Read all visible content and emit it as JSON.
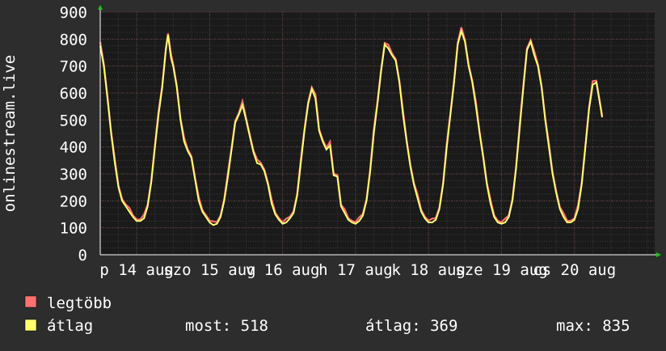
{
  "chart_data": {
    "type": "line",
    "ylabel": "onlinestream.live",
    "ylim": [
      0,
      900
    ],
    "yticks": [
      0,
      100,
      200,
      300,
      400,
      500,
      600,
      700,
      800,
      900
    ],
    "xlim_days": [
      0,
      7.6
    ],
    "xticks": [
      {
        "label": "p 14 aug",
        "day": 0.5
      },
      {
        "label": "szo 15 aug",
        "day": 1.5
      },
      {
        "label": "v 16 aug",
        "day": 2.5
      },
      {
        "label": "h 17 aug",
        "day": 3.5
      },
      {
        "label": "k 18 aug",
        "day": 4.5
      },
      {
        "label": "sze 19 aug",
        "day": 5.5
      },
      {
        "label": "cs 20 aug",
        "day": 6.5
      }
    ],
    "grid": true,
    "legend_placement": "bottom-left",
    "series": [
      {
        "name": "legtöbb",
        "color": "#ff7070"
      },
      {
        "name": "átlag",
        "color": "#ffff70"
      }
    ],
    "points_day_value": [
      [
        0.0,
        775
      ],
      [
        0.05,
        700
      ],
      [
        0.1,
        580
      ],
      [
        0.15,
        450
      ],
      [
        0.2,
        340
      ],
      [
        0.25,
        250
      ],
      [
        0.3,
        200
      ],
      [
        0.35,
        180
      ],
      [
        0.4,
        160
      ],
      [
        0.45,
        140
      ],
      [
        0.5,
        125
      ],
      [
        0.55,
        125
      ],
      [
        0.6,
        135
      ],
      [
        0.65,
        180
      ],
      [
        0.7,
        270
      ],
      [
        0.75,
        400
      ],
      [
        0.8,
        520
      ],
      [
        0.85,
        620
      ],
      [
        0.9,
        760
      ],
      [
        0.93,
        815
      ],
      [
        0.97,
        730
      ],
      [
        1.0,
        700
      ],
      [
        1.05,
        620
      ],
      [
        1.1,
        500
      ],
      [
        1.15,
        420
      ],
      [
        1.2,
        385
      ],
      [
        1.25,
        360
      ],
      [
        1.3,
        280
      ],
      [
        1.35,
        200
      ],
      [
        1.4,
        160
      ],
      [
        1.45,
        140
      ],
      [
        1.5,
        120
      ],
      [
        1.55,
        110
      ],
      [
        1.6,
        115
      ],
      [
        1.65,
        140
      ],
      [
        1.7,
        200
      ],
      [
        1.75,
        290
      ],
      [
        1.8,
        390
      ],
      [
        1.85,
        490
      ],
      [
        1.9,
        520
      ],
      [
        1.95,
        555
      ],
      [
        2.0,
        500
      ],
      [
        2.05,
        440
      ],
      [
        2.1,
        380
      ],
      [
        2.15,
        340
      ],
      [
        2.2,
        335
      ],
      [
        2.25,
        310
      ],
      [
        2.3,
        260
      ],
      [
        2.35,
        190
      ],
      [
        2.4,
        150
      ],
      [
        2.45,
        130
      ],
      [
        2.5,
        115
      ],
      [
        2.55,
        120
      ],
      [
        2.6,
        135
      ],
      [
        2.65,
        155
      ],
      [
        2.7,
        220
      ],
      [
        2.75,
        340
      ],
      [
        2.8,
        460
      ],
      [
        2.85,
        560
      ],
      [
        2.9,
        615
      ],
      [
        2.95,
        580
      ],
      [
        3.0,
        460
      ],
      [
        3.05,
        420
      ],
      [
        3.1,
        390
      ],
      [
        3.15,
        405
      ],
      [
        3.2,
        295
      ],
      [
        3.25,
        290
      ],
      [
        3.3,
        180
      ],
      [
        3.35,
        155
      ],
      [
        3.4,
        130
      ],
      [
        3.45,
        120
      ],
      [
        3.5,
        115
      ],
      [
        3.55,
        125
      ],
      [
        3.6,
        145
      ],
      [
        3.65,
        200
      ],
      [
        3.7,
        310
      ],
      [
        3.75,
        450
      ],
      [
        3.8,
        560
      ],
      [
        3.85,
        680
      ],
      [
        3.9,
        780
      ],
      [
        3.95,
        765
      ],
      [
        4.0,
        740
      ],
      [
        4.05,
        720
      ],
      [
        4.1,
        640
      ],
      [
        4.15,
        520
      ],
      [
        4.2,
        420
      ],
      [
        4.25,
        330
      ],
      [
        4.3,
        260
      ],
      [
        4.35,
        210
      ],
      [
        4.4,
        160
      ],
      [
        4.45,
        135
      ],
      [
        4.5,
        120
      ],
      [
        4.55,
        120
      ],
      [
        4.6,
        130
      ],
      [
        4.65,
        170
      ],
      [
        4.7,
        260
      ],
      [
        4.75,
        400
      ],
      [
        4.8,
        520
      ],
      [
        4.85,
        640
      ],
      [
        4.9,
        780
      ],
      [
        4.95,
        830
      ],
      [
        5.0,
        790
      ],
      [
        5.05,
        700
      ],
      [
        5.1,
        640
      ],
      [
        5.15,
        550
      ],
      [
        5.2,
        450
      ],
      [
        5.25,
        360
      ],
      [
        5.3,
        260
      ],
      [
        5.35,
        190
      ],
      [
        5.4,
        140
      ],
      [
        5.45,
        120
      ],
      [
        5.5,
        115
      ],
      [
        5.55,
        120
      ],
      [
        5.6,
        140
      ],
      [
        5.65,
        200
      ],
      [
        5.7,
        320
      ],
      [
        5.75,
        470
      ],
      [
        5.8,
        620
      ],
      [
        5.85,
        760
      ],
      [
        5.9,
        790
      ],
      [
        5.95,
        740
      ],
      [
        6.0,
        700
      ],
      [
        6.05,
        620
      ],
      [
        6.1,
        500
      ],
      [
        6.15,
        400
      ],
      [
        6.2,
        300
      ],
      [
        6.25,
        230
      ],
      [
        6.3,
        170
      ],
      [
        6.35,
        140
      ],
      [
        6.4,
        120
      ],
      [
        6.45,
        120
      ],
      [
        6.5,
        130
      ],
      [
        6.55,
        170
      ],
      [
        6.6,
        260
      ],
      [
        6.65,
        400
      ],
      [
        6.7,
        540
      ],
      [
        6.75,
        630
      ],
      [
        6.8,
        640
      ],
      [
        6.85,
        560
      ],
      [
        6.88,
        510
      ]
    ]
  },
  "legend": {
    "items": [
      {
        "label": "legtöbb",
        "color": "#ff7070"
      },
      {
        "label": "átlag",
        "color": "#ffff70"
      }
    ],
    "stats": {
      "now": "most: 518",
      "avg": "átlag: 369",
      "max": "max: 835"
    }
  }
}
